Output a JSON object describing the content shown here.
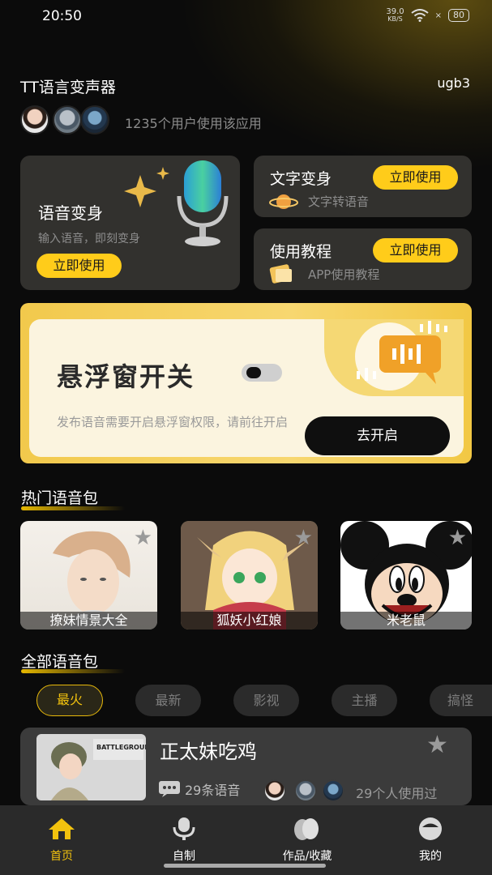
{
  "status_bar": {
    "time": "20:50",
    "net_speed_value": "39.0",
    "net_speed_unit": "KB/S",
    "battery": "80"
  },
  "header": {
    "title": "TT语言变声器",
    "user_code": "ugb3",
    "users_count_text": "1235个用户使用该应用"
  },
  "features": {
    "voice_change": {
      "title": "语音变身",
      "subtitle": "输入语音，即刻变身",
      "button": "立即使用"
    },
    "text_change": {
      "title": "文字变身",
      "subtitle": "文字转语音",
      "button": "立即使用"
    },
    "tutorial": {
      "title": "使用教程",
      "subtitle": "APP使用教程",
      "button": "立即使用"
    }
  },
  "float_window": {
    "title": "悬浮窗开关",
    "description": "发布语音需要开启悬浮窗权限，请前往开启",
    "button": "去开启",
    "toggle_on": false
  },
  "hot_section": {
    "title": "热门语音包",
    "packs": [
      {
        "label": "撩妹情景大全"
      },
      {
        "label": "狐妖小红娘"
      },
      {
        "label": "米老鼠"
      }
    ]
  },
  "all_section": {
    "title": "全部语音包",
    "tabs": [
      {
        "label": "最火",
        "active": true
      },
      {
        "label": "最新",
        "active": false
      },
      {
        "label": "影视",
        "active": false
      },
      {
        "label": "主播",
        "active": false
      },
      {
        "label": "搞怪",
        "active": false
      }
    ],
    "items": [
      {
        "title": "正太妹吃鸡",
        "voice_count": "29条语音",
        "users_used": "29个人使用过",
        "thumb_text": "BATTLEGROUNDS"
      }
    ]
  },
  "bottom_nav": [
    {
      "label": "首页",
      "icon": "home-icon",
      "active": true
    },
    {
      "label": "自制",
      "icon": "mic-icon",
      "active": false
    },
    {
      "label": "作品/收藏",
      "icon": "works-icon",
      "active": false
    },
    {
      "label": "我的",
      "icon": "profile-icon",
      "active": false
    }
  ],
  "colors": {
    "accent": "#ffcc1a",
    "background": "#0b0b0b",
    "card": "#3e3c38",
    "nav": "#2a2a2a"
  }
}
